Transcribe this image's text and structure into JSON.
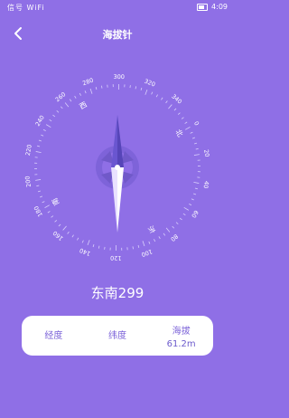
{
  "status": {
    "left": "信号 WiFi",
    "time": "4:09"
  },
  "header": {
    "title": "海拔针"
  },
  "compass": {
    "degree_labels": [
      "0",
      "20",
      "40",
      "60",
      "80",
      "100",
      "120",
      "140",
      "160",
      "180",
      "200",
      "220",
      "240",
      "260",
      "280",
      "300",
      "320",
      "340"
    ],
    "directions": [
      "北",
      "东",
      "南",
      "西"
    ],
    "heading_degree": 299
  },
  "readout": {
    "heading_text": "东南299"
  },
  "info": {
    "longitude_label": "经度",
    "longitude_value": "",
    "latitude_label": "纬度",
    "latitude_value": "",
    "altitude_label": "海拔",
    "altitude_value": "61.2m"
  },
  "colors": {
    "background": "#8f6fe6",
    "needle_light": "#ffffff",
    "ring": "#b4a0f1"
  }
}
